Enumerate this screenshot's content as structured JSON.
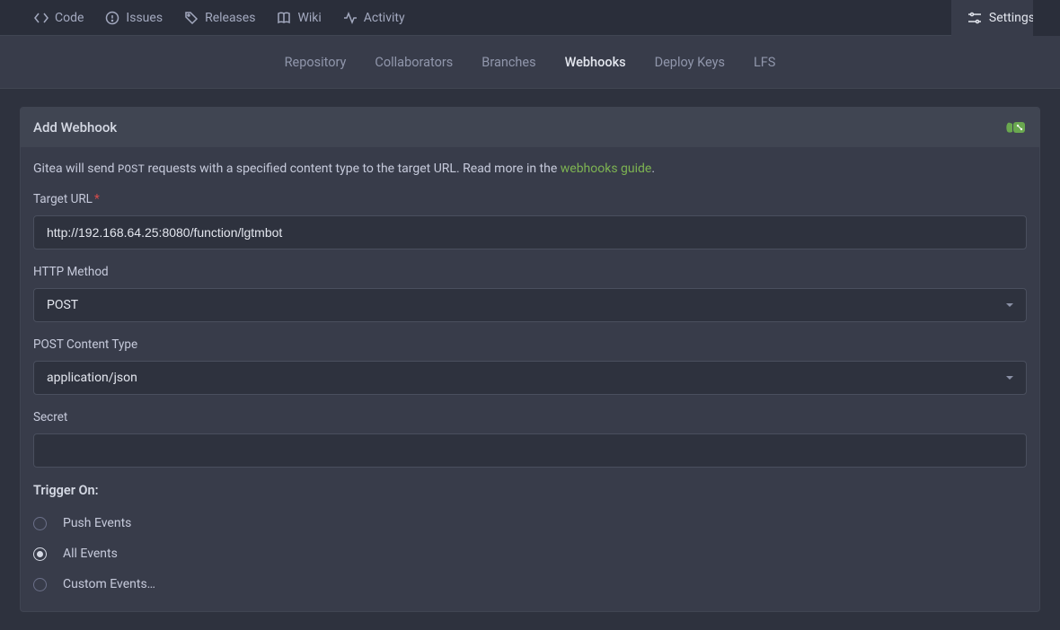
{
  "top_nav": {
    "code": "Code",
    "issues": "Issues",
    "releases": "Releases",
    "wiki": "Wiki",
    "activity": "Activity",
    "settings": "Settings"
  },
  "sub_nav": {
    "repository": "Repository",
    "collaborators": "Collaborators",
    "branches": "Branches",
    "webhooks": "Webhooks",
    "deploy_keys": "Deploy Keys",
    "lfs": "LFS"
  },
  "panel": {
    "title": "Add Webhook"
  },
  "intro": {
    "prefix": "Gitea will send ",
    "code": "POST",
    "mid": " requests with a specified content type to the target URL. Read more in the ",
    "link": "webhooks guide",
    "suffix": "."
  },
  "form": {
    "target_url_label": "Target URL",
    "target_url_value": "http://192.168.64.25:8080/function/lgtmbot",
    "http_method_label": "HTTP Method",
    "http_method_value": "POST",
    "content_type_label": "POST Content Type",
    "content_type_value": "application/json",
    "secret_label": "Secret",
    "secret_value": ""
  },
  "trigger": {
    "heading": "Trigger On:",
    "push": "Push Events",
    "all": "All Events",
    "custom": "Custom Events…",
    "selected": "all"
  }
}
